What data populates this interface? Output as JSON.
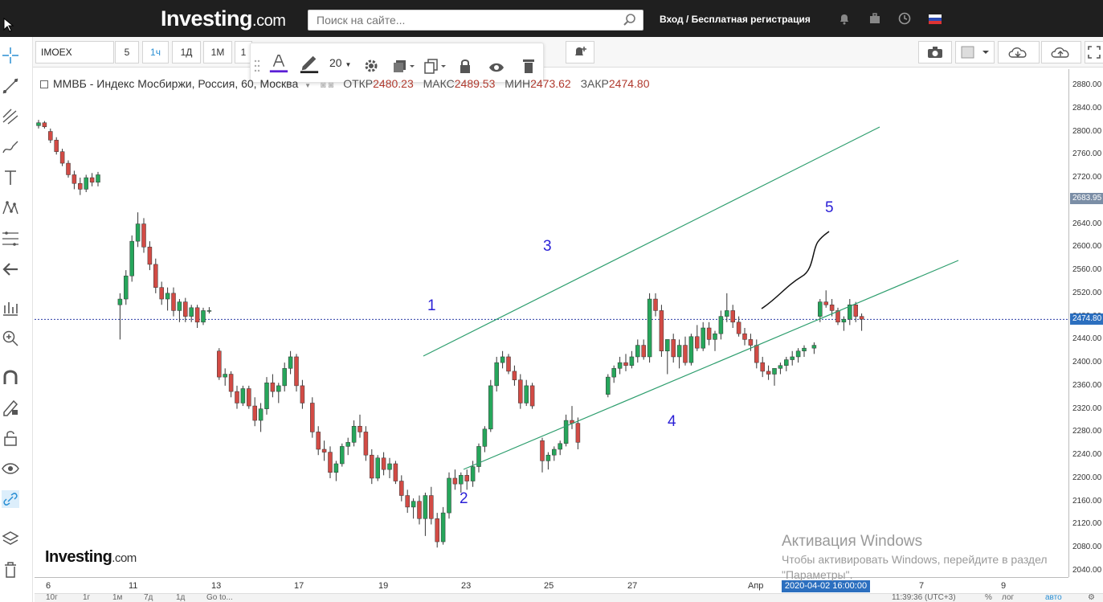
{
  "header": {
    "logo_main": "Investing",
    "logo_dot": ".com",
    "search_placeholder": "Поиск на сайте...",
    "login_label": "Вход / Бесплатная регистрация"
  },
  "toolbar": {
    "symbol": "IMOEX",
    "intervals": [
      {
        "label": "5"
      },
      {
        "label": "1ч"
      },
      {
        "label": "1Д"
      },
      {
        "label": "1М"
      },
      {
        "label": "1"
      }
    ],
    "active_interval": "1ч",
    "font_size": "20"
  },
  "legend": {
    "title": "ММВБ - Индекс Мосбиржи, Россия, 60, Москва",
    "open_label": "ОТКР",
    "open_value": "2480.23",
    "high_label": "МАКС",
    "high_value": "2489.53",
    "low_label": "МИН",
    "low_value": "2473.62",
    "close_label": "ЗАКР",
    "close_value": "2474.80"
  },
  "chart_data": {
    "type": "candlestick",
    "yticks": [
      "2880.00",
      "2840.00",
      "2800.00",
      "2760.00",
      "2720.00",
      "2680.00",
      "2640.00",
      "2600.00",
      "2560.00",
      "2520.00",
      "2480.00",
      "2440.00",
      "2400.00",
      "2360.00",
      "2320.00",
      "2280.00",
      "2240.00",
      "2200.00",
      "2160.00",
      "2120.00",
      "2080.00",
      "2040.00"
    ],
    "ylim": [
      2030,
      2895
    ],
    "xticks": [
      "6",
      "11",
      "13",
      "17",
      "19",
      "23",
      "25",
      "27",
      "Апр",
      "7",
      "9"
    ],
    "x_selected_label": "2020-04-02 16:00:00",
    "last_price_label": "2683.95",
    "crosshair_price_label": "2474.80",
    "crosshair_price": 2474.8,
    "colors": {
      "up": "#26a65b",
      "down": "#d24b45",
      "channel": "#2e9e6e",
      "projection": "#111111",
      "crosshair": "#2c3fa8",
      "last_badge": "#7b8ea6",
      "cross_badge": "#2c6fbf"
    },
    "candles": [
      [
        2810,
        2820,
        2805,
        2815
      ],
      [
        2815,
        2818,
        2805,
        2808
      ],
      [
        2800,
        2805,
        2780,
        2785
      ],
      [
        2785,
        2790,
        2760,
        2765
      ],
      [
        2765,
        2770,
        2740,
        2745
      ],
      [
        2745,
        2750,
        2720,
        2725
      ],
      [
        2725,
        2732,
        2700,
        2710
      ],
      [
        2710,
        2720,
        2690,
        2700
      ],
      [
        2700,
        2725,
        2695,
        2720
      ],
      [
        2720,
        2728,
        2705,
        2712
      ],
      [
        2712,
        2730,
        2705,
        2725
      ],
      [
        2500,
        2520,
        2440,
        2510
      ],
      [
        2510,
        2560,
        2500,
        2550
      ],
      [
        2550,
        2620,
        2540,
        2610
      ],
      [
        2610,
        2660,
        2600,
        2640
      ],
      [
        2640,
        2650,
        2590,
        2600
      ],
      [
        2600,
        2610,
        2560,
        2570
      ],
      [
        2570,
        2580,
        2520,
        2530
      ],
      [
        2530,
        2540,
        2500,
        2510
      ],
      [
        2510,
        2530,
        2490,
        2520
      ],
      [
        2520,
        2530,
        2480,
        2490
      ],
      [
        2490,
        2510,
        2470,
        2505
      ],
      [
        2505,
        2512,
        2470,
        2480
      ],
      [
        2480,
        2500,
        2470,
        2495
      ],
      [
        2495,
        2500,
        2460,
        2470
      ],
      [
        2470,
        2495,
        2465,
        2490
      ],
      [
        2490,
        2496,
        2485,
        2490
      ],
      [
        2420,
        2425,
        2370,
        2375
      ],
      [
        2375,
        2390,
        2360,
        2380
      ],
      [
        2380,
        2385,
        2340,
        2350
      ],
      [
        2350,
        2360,
        2320,
        2330
      ],
      [
        2330,
        2360,
        2325,
        2355
      ],
      [
        2355,
        2360,
        2320,
        2325
      ],
      [
        2325,
        2340,
        2290,
        2300
      ],
      [
        2300,
        2330,
        2280,
        2320
      ],
      [
        2320,
        2375,
        2310,
        2365
      ],
      [
        2365,
        2380,
        2340,
        2350
      ],
      [
        2350,
        2365,
        2330,
        2360
      ],
      [
        2360,
        2400,
        2350,
        2390
      ],
      [
        2390,
        2420,
        2380,
        2410
      ],
      [
        2410,
        2415,
        2350,
        2360
      ],
      [
        2360,
        2370,
        2320,
        2330
      ],
      [
        2330,
        2340,
        2270,
        2280
      ],
      [
        2280,
        2290,
        2240,
        2250
      ],
      [
        2250,
        2265,
        2230,
        2245
      ],
      [
        2245,
        2255,
        2200,
        2210
      ],
      [
        2210,
        2230,
        2195,
        2225
      ],
      [
        2225,
        2260,
        2220,
        2255
      ],
      [
        2255,
        2270,
        2240,
        2262
      ],
      [
        2262,
        2300,
        2255,
        2290
      ],
      [
        2290,
        2310,
        2270,
        2280
      ],
      [
        2280,
        2290,
        2230,
        2240
      ],
      [
        2240,
        2250,
        2190,
        2200
      ],
      [
        2200,
        2240,
        2195,
        2235
      ],
      [
        2235,
        2245,
        2205,
        2215
      ],
      [
        2215,
        2235,
        2200,
        2225
      ],
      [
        2225,
        2230,
        2190,
        2195
      ],
      [
        2195,
        2205,
        2160,
        2170
      ],
      [
        2170,
        2180,
        2140,
        2150
      ],
      [
        2150,
        2165,
        2130,
        2160
      ],
      [
        2160,
        2170,
        2120,
        2130
      ],
      [
        2130,
        2175,
        2100,
        2170
      ],
      [
        2170,
        2185,
        2120,
        2130
      ],
      [
        2130,
        2140,
        2080,
        2090
      ],
      [
        2090,
        2150,
        2085,
        2140
      ],
      [
        2140,
        2210,
        2130,
        2200
      ],
      [
        2200,
        2215,
        2180,
        2190
      ],
      [
        2190,
        2210,
        2175,
        2205
      ],
      [
        2205,
        2215,
        2180,
        2195
      ],
      [
        2195,
        2230,
        2185,
        2220
      ],
      [
        2220,
        2260,
        2210,
        2255
      ],
      [
        2255,
        2290,
        2245,
        2285
      ],
      [
        2285,
        2370,
        2280,
        2360
      ],
      [
        2360,
        2410,
        2350,
        2400
      ],
      [
        2400,
        2420,
        2390,
        2410
      ],
      [
        2410,
        2415,
        2380,
        2385
      ],
      [
        2385,
        2395,
        2360,
        2370
      ],
      [
        2370,
        2380,
        2320,
        2330
      ],
      [
        2330,
        2370,
        2325,
        2360
      ],
      [
        2360,
        2365,
        2320,
        2325
      ],
      [
        2265,
        2270,
        2210,
        2230
      ],
      [
        2230,
        2245,
        2215,
        2240
      ],
      [
        2240,
        2255,
        2230,
        2250
      ],
      [
        2250,
        2265,
        2240,
        2260
      ],
      [
        2260,
        2310,
        2255,
        2300
      ],
      [
        2300,
        2325,
        2285,
        2295
      ],
      [
        2295,
        2305,
        2250,
        2262
      ],
      [
        2345,
        2380,
        2340,
        2375
      ],
      [
        2375,
        2395,
        2365,
        2390
      ],
      [
        2390,
        2410,
        2380,
        2400
      ],
      [
        2400,
        2415,
        2385,
        2395
      ],
      [
        2395,
        2420,
        2390,
        2410
      ],
      [
        2410,
        2440,
        2400,
        2430
      ],
      [
        2430,
        2440,
        2405,
        2410
      ],
      [
        2410,
        2520,
        2400,
        2510
      ],
      [
        2510,
        2520,
        2480,
        2490
      ],
      [
        2490,
        2500,
        2410,
        2420
      ],
      [
        2420,
        2430,
        2380,
        2440
      ],
      [
        2440,
        2450,
        2400,
        2410
      ],
      [
        2410,
        2440,
        2390,
        2430
      ],
      [
        2430,
        2445,
        2395,
        2400
      ],
      [
        2400,
        2450,
        2395,
        2445
      ],
      [
        2445,
        2465,
        2420,
        2425
      ],
      [
        2425,
        2470,
        2420,
        2460
      ],
      [
        2460,
        2470,
        2430,
        2440
      ],
      [
        2440,
        2455,
        2420,
        2450
      ],
      [
        2450,
        2490,
        2440,
        2480
      ],
      [
        2480,
        2520,
        2470,
        2490
      ],
      [
        2490,
        2500,
        2460,
        2470
      ],
      [
        2470,
        2480,
        2445,
        2450
      ],
      [
        2450,
        2460,
        2430,
        2440
      ],
      [
        2440,
        2450,
        2420,
        2430
      ],
      [
        2430,
        2440,
        2390,
        2400
      ],
      [
        2400,
        2410,
        2375,
        2385
      ],
      [
        2385,
        2395,
        2370,
        2380
      ],
      [
        2380,
        2390,
        2360,
        2390
      ],
      [
        2390,
        2400,
        2380,
        2395
      ],
      [
        2395,
        2410,
        2385,
        2405
      ],
      [
        2405,
        2420,
        2395,
        2410
      ],
      [
        2410,
        2425,
        2400,
        2420
      ],
      [
        2420,
        2430,
        2410,
        2425
      ],
      [
        2425,
        2435,
        2415,
        2430
      ],
      [
        2480,
        2510,
        2470,
        2505
      ],
      [
        2505,
        2525,
        2495,
        2500
      ],
      [
        2500,
        2510,
        2480,
        2490
      ],
      [
        2490,
        2495,
        2465,
        2470
      ],
      [
        2470,
        2480,
        2455,
        2475
      ],
      [
        2475,
        2510,
        2465,
        2500
      ],
      [
        2500,
        2505,
        2470,
        2480
      ],
      [
        2480,
        2485,
        2455,
        2475
      ]
    ]
  },
  "annotations": [
    "1",
    "2",
    "3",
    "4",
    "5"
  ],
  "watermark": {
    "main": "Investing",
    "dot": ".com"
  },
  "windows_notice": {
    "title": "Активация Windows",
    "line1": "Чтобы активировать Windows, перейдите в раздел",
    "line2": "\"Параметры\"."
  },
  "bottom_bar": {
    "ranges": [
      "10г",
      "1г",
      "1м",
      "7д",
      "1д"
    ],
    "goto": "Go to...",
    "clock": "11:39:36 (UTC+3)",
    "percent": "%",
    "log": "лог",
    "auto": "авто"
  }
}
